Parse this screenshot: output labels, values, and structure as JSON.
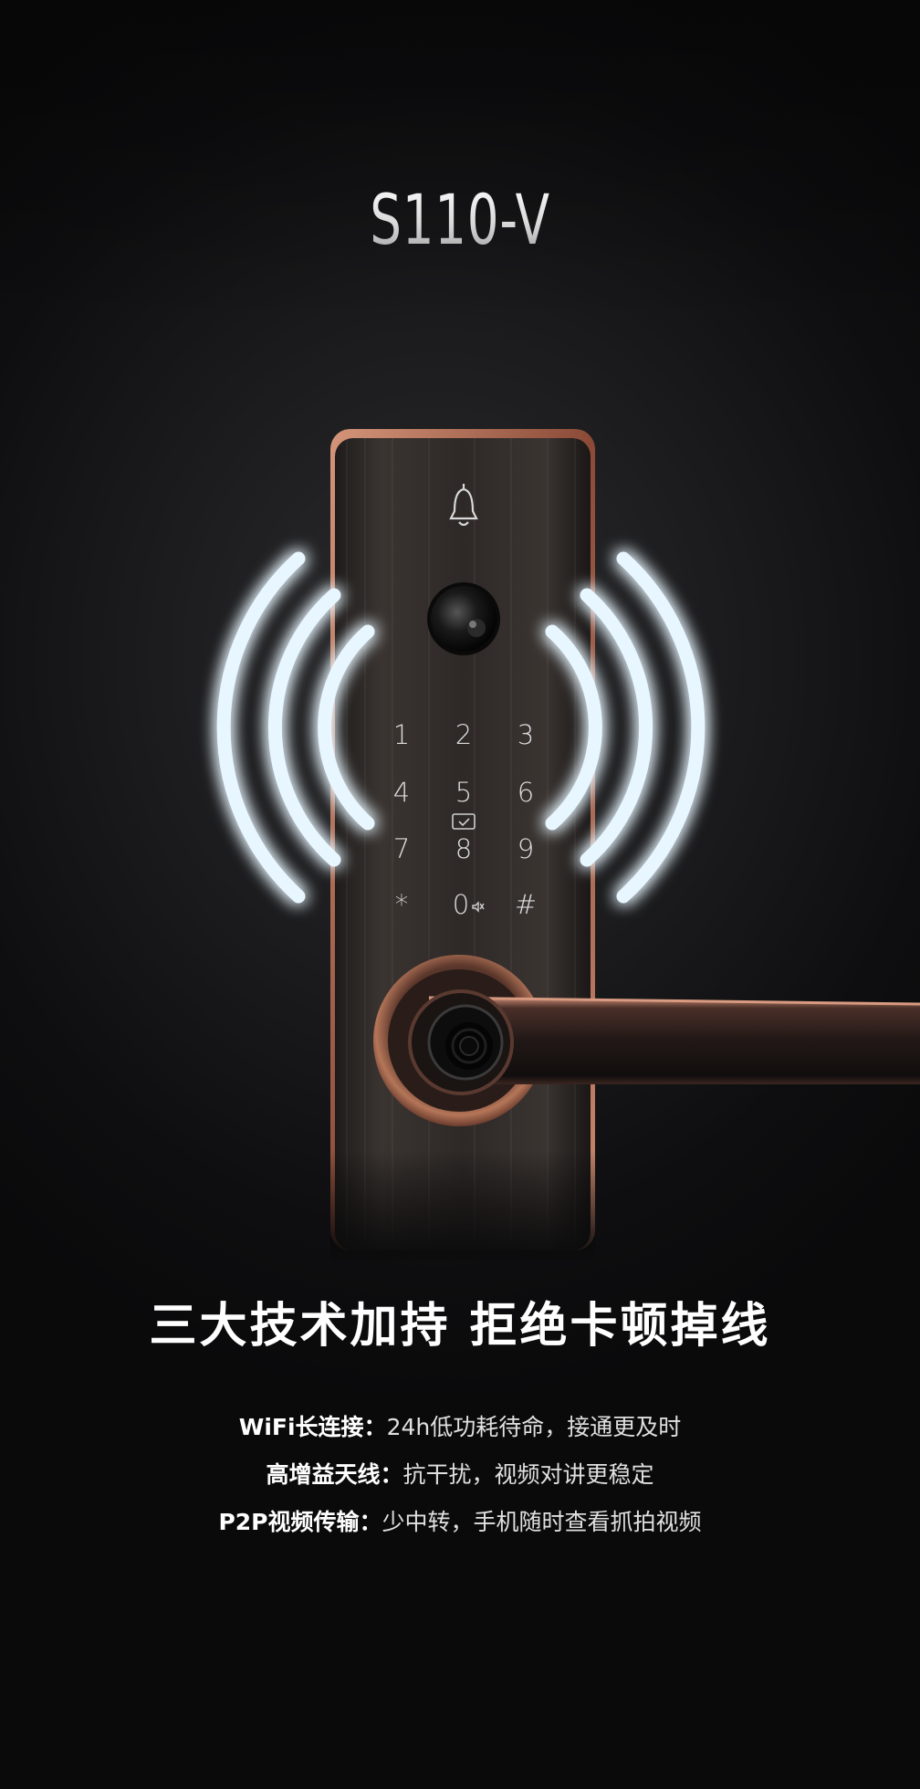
{
  "product": {
    "model": "S110-V"
  },
  "keypad": {
    "keys": [
      "1",
      "2",
      "3",
      "4",
      "5",
      "6",
      "7",
      "8",
      "9",
      "*",
      "0",
      "#"
    ]
  },
  "icons": {
    "doorbell": "bell-icon",
    "camera": "camera-lens-icon",
    "card_reader": "card-reader-icon",
    "mute": "mute-icon",
    "fingerprint": "fingerprint-sensor-icon",
    "signal": "wireless-signal-icon"
  },
  "colors": {
    "signal_glow": "#8fd8ff",
    "copper_trim": "#b87158",
    "panel": "#2a2523"
  },
  "headline": "三大技术加持 拒绝卡顿掉线",
  "features": [
    {
      "label": "WiFi长连接：",
      "desc": "24h低功耗待命，接通更及时"
    },
    {
      "label": "高增益天线：",
      "desc": "抗干扰，视频对讲更稳定"
    },
    {
      "label": "P2P视频传输：",
      "desc": "少中转，手机随时查看抓拍视频"
    }
  ]
}
